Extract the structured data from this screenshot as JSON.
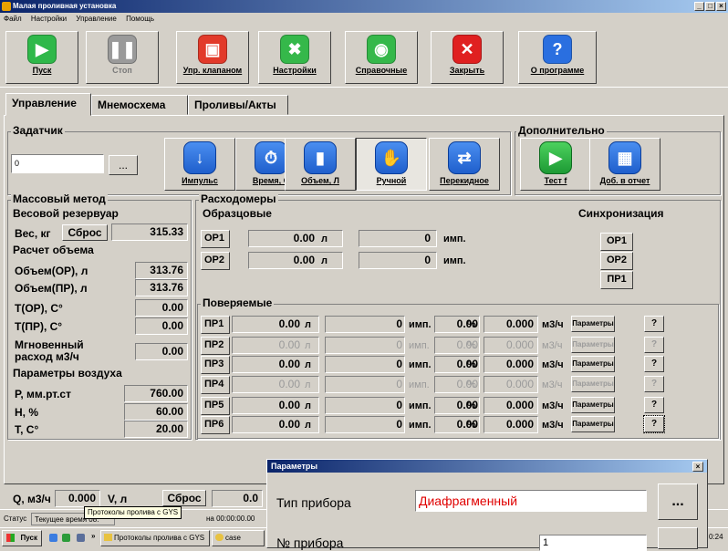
{
  "window": {
    "title": "Малая проливная установка",
    "min": "_",
    "max": "□",
    "close": "×"
  },
  "menu": [
    "Файл",
    "Настройки",
    "Управление",
    "Помощь"
  ],
  "toolbar": [
    {
      "label": "Пуск",
      "icon": "play-icon",
      "color": "#2fb84a"
    },
    {
      "label": "Стоп",
      "icon": "pause-icon",
      "color": "#9a9a9a"
    },
    {
      "label": "Упр. клапаном",
      "icon": "valve-icon",
      "color": "#e23a2a"
    },
    {
      "label": "Настройки",
      "icon": "tools-icon",
      "color": "#35b84a"
    },
    {
      "label": "Справочные",
      "icon": "reference-icon",
      "color": "#35b84a"
    },
    {
      "label": "Закрыть",
      "icon": "close-icon",
      "color": "#e02020"
    },
    {
      "label": "О программе",
      "icon": "help-icon",
      "color": "#2a6fe0"
    }
  ],
  "tabs": [
    "Управление",
    "Мнемосхема",
    "Проливы/Акты"
  ],
  "zadatchik": {
    "title": "Задатчик",
    "value": "0",
    "dots": "...",
    "buttons": [
      "Импульс",
      "Время, С",
      "Объем, Л",
      "Ручной",
      "Перекидное"
    ]
  },
  "dop": {
    "title": "Дополнительно",
    "buttons": [
      "Тест f",
      "Доб. в отчет"
    ]
  },
  "mass": {
    "title": "Массовый метод",
    "res_title": "Весовой резервуар",
    "ves_label": "Вес, кг",
    "reset": "Сброс",
    "ves_value": "315.33",
    "calc_title": "Расчет объема",
    "rows": [
      {
        "label": "Объем(ОР), л",
        "value": "313.76"
      },
      {
        "label": "Объем(ПР), л",
        "value": "313.76"
      },
      {
        "label": "Т(ОР), С°",
        "value": "0.00"
      },
      {
        "label": "Т(ПР), С°",
        "value": "0.00"
      },
      {
        "label": "Мгновенный",
        "label2": "расход м3/ч",
        "value": "0.00"
      }
    ],
    "air_title": "Параметры воздуха",
    "air": [
      {
        "label": "Р, мм.рт.ст",
        "value": "760.00"
      },
      {
        "label": "Н, %",
        "value": "60.00"
      },
      {
        "label": "Т, С°",
        "value": "20.00"
      }
    ]
  },
  "flow": {
    "title": "Расходомеры",
    "ref_title": "Образцовые",
    "sync_title": "Синхронизация",
    "ref": [
      {
        "tag": "ОР1",
        "value": "0.00",
        "unit": "л",
        "imp": "0",
        "imp_unit": "имп."
      },
      {
        "tag": "ОР2",
        "value": "0.00",
        "unit": "л",
        "imp": "0",
        "imp_unit": "имп."
      }
    ],
    "sync": [
      "ОР1",
      "ОР2",
      "ПР1"
    ],
    "test_title": "Поверяемые",
    "test": [
      {
        "tag": "ПР1",
        "value": "0.00",
        "unit": "л",
        "imp": "0",
        "imp_unit": "имп.",
        "pct": "0.00",
        "pct_unit": "%",
        "flow": "0.000",
        "flow_unit": "м3/ч",
        "params": "Параметры",
        "q": "?",
        "active": true
      },
      {
        "tag": "ПР2",
        "value": "0.00",
        "unit": "л",
        "imp": "0",
        "imp_unit": "имп.",
        "pct": "0.00",
        "pct_unit": "%",
        "flow": "0.000",
        "flow_unit": "м3/ч",
        "params": "Параметры",
        "q": "?",
        "active": false
      },
      {
        "tag": "ПР3",
        "value": "0.00",
        "unit": "л",
        "imp": "0",
        "imp_unit": "имп.",
        "pct": "0.00",
        "pct_unit": "%",
        "flow": "0.000",
        "flow_unit": "м3/ч",
        "params": "Параметры",
        "q": "?",
        "active": true
      },
      {
        "tag": "ПР4",
        "value": "0.00",
        "unit": "л",
        "imp": "0",
        "imp_unit": "имп.",
        "pct": "0.00",
        "pct_unit": "%",
        "flow": "0.000",
        "flow_unit": "м3/ч",
        "params": "Параметры",
        "q": "?",
        "active": false
      },
      {
        "tag": "ПР5",
        "value": "0.00",
        "unit": "л",
        "imp": "0",
        "imp_unit": "имп.",
        "pct": "0.00",
        "pct_unit": "%",
        "flow": "0.000",
        "flow_unit": "м3/ч",
        "params": "Параметры",
        "q": "?",
        "active": true
      },
      {
        "tag": "ПР6",
        "value": "0.00",
        "unit": "л",
        "imp": "0",
        "imp_unit": "имп.",
        "pct": "0.00",
        "pct_unit": "%",
        "flow": "0.000",
        "flow_unit": "м3/ч",
        "params": "Параметры",
        "q": "?",
        "active": true
      }
    ]
  },
  "bottom": {
    "q_label": "Q, м3/ч",
    "q_value": "0.000",
    "v_label": "V, л",
    "reset": "Сброс",
    "v_value": "0.0"
  },
  "status": {
    "label": "Статус",
    "time": "Текущее время 08.",
    "tooltip": "Протоколы пролива с GYS",
    "elapsed": "на 00:00:00.00"
  },
  "taskbar": {
    "start": "Пуск",
    "item1": "Протоколы пролива с GYS",
    "item2": "case",
    "clock": "0:24"
  },
  "dialog": {
    "title": "Параметры",
    "close": "×",
    "type_label": "Тип прибора",
    "type_value": "Диафрагменный",
    "dots": "...",
    "num_label": "№ прибора",
    "num_value": "1"
  }
}
